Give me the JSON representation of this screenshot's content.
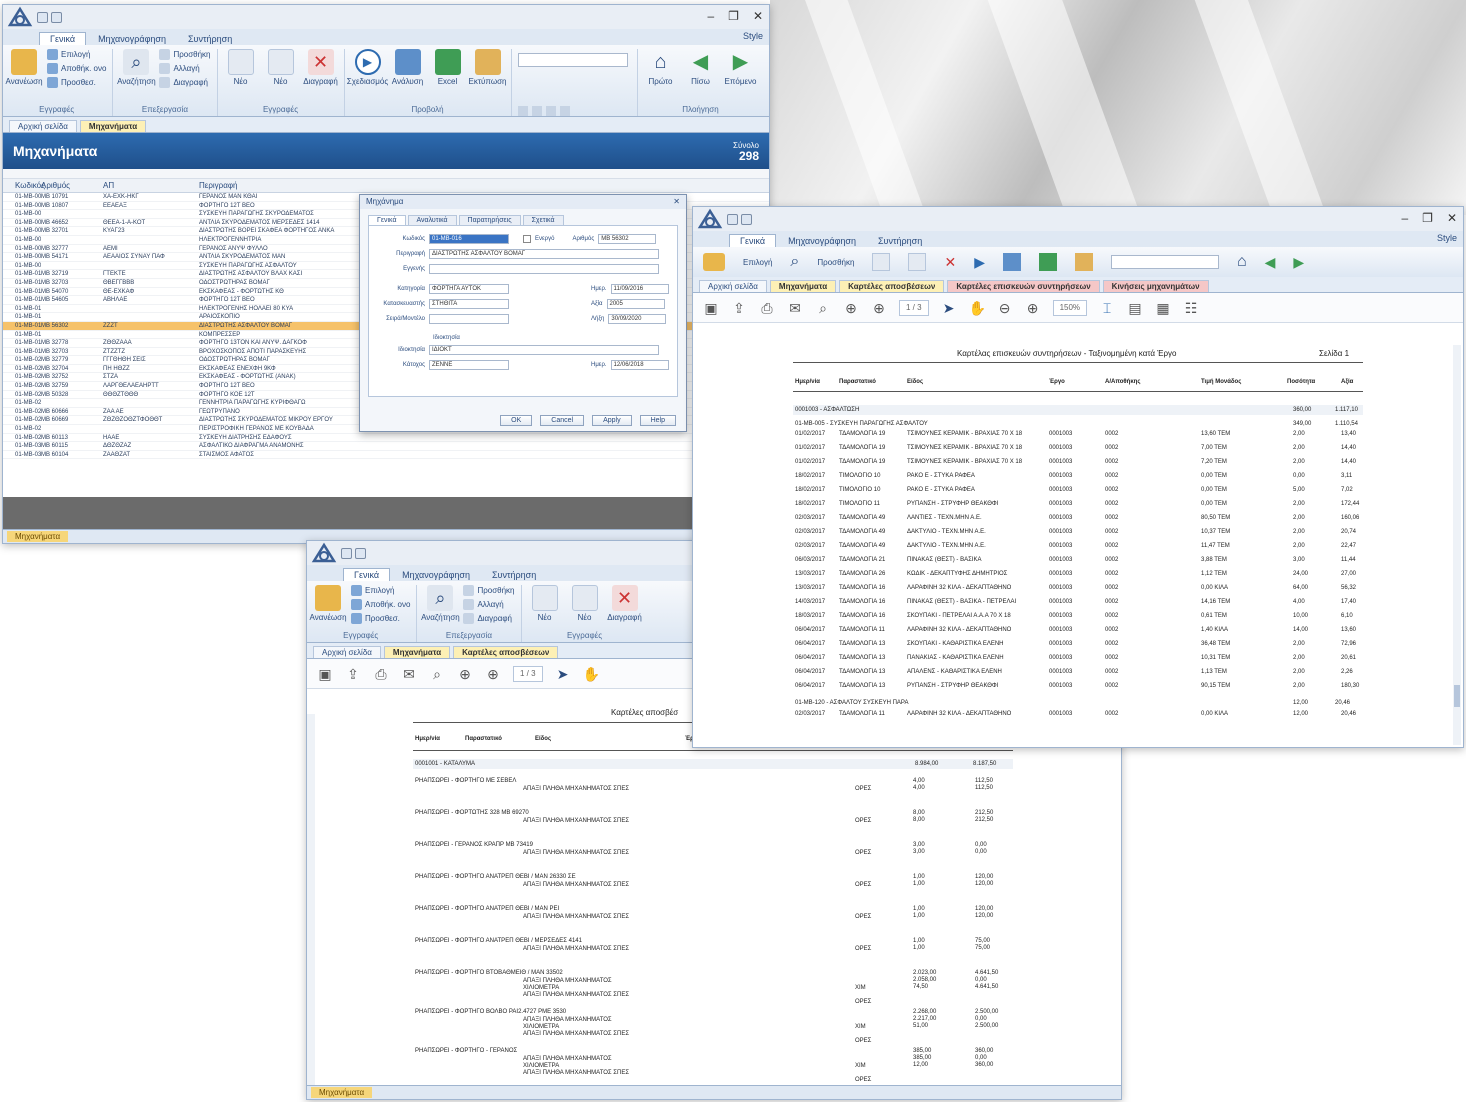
{
  "common": {
    "ribbon_tabs": [
      "Γενικά",
      "Μηχανογράφηση",
      "Συντήρηση"
    ],
    "style_label": "Style",
    "window_controls": [
      "–",
      "❐",
      "✕"
    ],
    "ribbon_groups": [
      {
        "label": "Εγγραφές",
        "big": "Ανανέωση",
        "small": [
          "Επιλογή",
          "Αποθήκ. ονο",
          "Προσθεσ."
        ]
      },
      {
        "label": "Επεξεργασία",
        "big": "Αναζήτηση",
        "small": [
          "Προσθήκη",
          "Αλλαγή",
          "Διαγραφή"
        ]
      },
      {
        "label": "Εγγραφές",
        "big": "",
        "small": [
          "Νέο",
          "Νέο",
          "Διαγραφή"
        ]
      },
      {
        "label": "Προβολή",
        "big": "",
        "small": [
          "Σχεδιασμός",
          "Ανάλυση",
          "Excel",
          "Εκτύπωση"
        ]
      },
      {
        "label": "Πλοήγηση",
        "big": "",
        "small": [
          "Πρώτο",
          "Πίσω",
          "Επόμενο"
        ]
      }
    ]
  },
  "window1": {
    "doc_tabs": [
      "Αρχική σελίδα",
      "Μηχανήματα"
    ],
    "header_title": "Μηχανήματα",
    "count_label": "Σύνολο",
    "count_value": "298",
    "columns": [
      "Κωδικός",
      "Αριθμός",
      "ΑΠ",
      "Περιγραφή"
    ],
    "rows": [
      [
        "01-ΜΒ-001",
        "ΜΒ 10791",
        "ΧΑ-ΕΧΚ-ΗΚΓ",
        "ΓΕΡΑΝΟΣ ΜΑΝ ΚΘΑΙ"
      ],
      [
        "01-ΜΒ-002",
        "ΜΒ 10807",
        "ΕΕΑΕΑΞ",
        "ΦΟΡΤΗΓΟ 12Τ ΒΕΟ"
      ],
      [
        "01-ΜΒ-003",
        "",
        "",
        "ΣΥΣΚΕΥΗ ΠΑΡΑΓΩΓΗΣ ΣΚΥΡΟΔΕΜΑΤΟΣ"
      ],
      [
        "01-ΜΒ-004",
        "ΜΒ 46652",
        "ΘΕΕΑ-1-Α-ΚΟΤ",
        "ΑΝΤΛΙΑ ΣΚΥΡΟΔΕΜΑΤΟΣ ΜΕΡΣΕΔΕΣ 1414"
      ],
      [
        "01-ΜΒ-005",
        "ΜΒ 32701",
        "ΚΥΑΓ23",
        "ΔΙΑΣΤΡΩΤΗΣ ΒΟΡΕΙ ΣΚΑΦΕΑ ΦΟΡΤΗΓΟΣ ΑΝΚΑ"
      ],
      [
        "01-ΜΒ-006",
        "",
        "",
        "ΗΛΕΚΤΡΟΓΕΝΝΗΤΡΙΑ"
      ],
      [
        "01-ΜΒ-007",
        "ΜΒ 32777",
        "ΑΕΜΙ",
        "ΓΕΡΑΝΟΣ ΑΝΥΨ ΦΥΛΛΟ"
      ],
      [
        "01-ΜΒ-008",
        "ΜΒ 54171",
        "ΑΕΑΑΙΟΣ ΣΥΝΑΥ ΠΑΦ",
        "ΑΝΤΛΙΑ ΣΚΥΡΟΔΕΜΑΤΟΣ ΜΑΝ"
      ],
      [
        "01-ΜΒ-009",
        "",
        "",
        "ΣΥΣΚΕΥΗ ΠΑΡΑΓΩΓΗΣ ΑΣΦΑΛΤΟΥ"
      ],
      [
        "01-ΜΒ-010",
        "ΜΒ 32719",
        "ΓΤΕΚΤΕ",
        "ΔΙΑΣΤΡΩΤΗΣ ΑΣΦΑΛΤΟΥ ΒΛΑΧ ΚΑΣΙ"
      ],
      [
        "01-ΜΒ-011",
        "ΜΒ 32703",
        "ΘΒΕΓΓΒΒΒ",
        "ΟΔΟΣΤΡΩΤΗΡΑΣ ΒΟΜΑΓ"
      ],
      [
        "01-ΜΒ-012",
        "ΜΒ 54070",
        "ΘΕ-ΕΧΚΑΦ",
        "ΕΚΣΚΑΦΕΑΣ - ΦΟΡΤΩΤΗΣ ΚΘ"
      ],
      [
        "01-ΜΒ-013",
        "ΜΒ 54605",
        "ΑΒΗΛΑΕ",
        "ΦΟΡΤΗΓΟ 12Τ ΒΕΟ"
      ],
      [
        "01-ΜΒ-014",
        "",
        "",
        "ΗΛΕΚΤΡΟΓΕΝΗΣ ΗΟΛΑΕΙ 80 ΚΥΑ"
      ],
      [
        "01-ΜΒ-015",
        "",
        "",
        "ΑΡΑΙΟΣΚΟΠΙΟ"
      ],
      [
        "01-ΜΒ-016",
        "ΜΒ 56302",
        "ΖΖΖΤ",
        "ΔΙΑΣΤΡΩΤΗΣ ΑΣΦΑΛΤΟΥ ΒΟΜΑΓ"
      ],
      [
        "01-ΜΒ-017",
        "",
        "",
        "ΚΟΜΠΡΕΣΣΕΡ"
      ],
      [
        "01-ΜΒ-018",
        "ΜΒ 32778",
        "ΖΘΘΖΑΑΑ",
        "ΦΟΡΤΗΓΟ 13ΤΟΝ ΚΑΙ ΑΝΥΨ. ΔΑΓΚΟΦ"
      ],
      [
        "01-ΜΒ-019",
        "ΜΒ 32703",
        "ΖΤΖΖΤΖ",
        "ΒΡΟΧΟΣΚΟΠΟΣ ΑΠΟΤΙ ΠΑΡΑΣΚΕΥΗΣ"
      ],
      [
        "01-ΜΒ-020",
        "ΜΒ 32779",
        "ΓΓΓΘΗΘΗ ΣΕΙΣ",
        "ΟΔΟΣΤΡΩΤΗΡΑΣ ΒΟΜΑΓ"
      ],
      [
        "01-ΜΒ-021",
        "ΜΒ 32704",
        "ΠΗ ΗΘΖΖ",
        "ΕΚΣΚΑΦΕΑΣ ΕΝΕΧΦΗ 9ΚΦ"
      ],
      [
        "01-ΜΒ-022",
        "ΜΒ 32752",
        "ΣΤΖΑ",
        "ΕΚΣΚΑΦΕΑΣ - ΦΟΡΤΩΤΗΣ (ΑΝΑΚ)"
      ],
      [
        "01-ΜΒ-023",
        "ΜΒ 32759",
        "ΛΑΡΓΘΕΛΑΕΑΗΡΤΤ",
        "ΦΟΡΤΗΓΟ 12Τ ΒΕΟ"
      ],
      [
        "01-ΜΒ-024",
        "ΜΒ 50328",
        "ΘΘΘΖΤΘΘΘ",
        "ΦΟΡΤΗΓΟ ΚΟΕ 12Τ"
      ],
      [
        "01-ΜΒ-025",
        "",
        "",
        "ΓΕΝΝΗΤΡΙΑ ΠΑΡΑΓΩΓΗΣ ΚΥΡΙΦΘΑΓΩ"
      ],
      [
        "01-ΜΒ-026",
        "ΜΒ 60666",
        "ΖΑΑ ΑΕ",
        "ΓΕΩΤΡΥΠΑΝΟ"
      ],
      [
        "01-ΜΒ-027",
        "ΜΒ 60669",
        "ΖΘΖΘΖΟΘΖΤΦΟΘΘΤ",
        "ΔΙΑΣΤΡΩΤΗΣ ΣΚΥΡΟΔΕΜΑΤΟΣ ΜΙΚΡΟΥ ΕΡΓΟΥ"
      ],
      [
        "01-ΜΒ-028",
        "",
        "",
        "ΠΕΡΙΣΤΡΟΦΙΚΗ ΓΕΡΑΝΟΣ ΜΕ ΚΟΥΒΑΔΑ"
      ],
      [
        "01-ΜΒ-029",
        "ΜΒ 60113",
        "ΗΑΑΕ",
        "ΣΥΣΚΕΥΗ ΔΙΑΤΡΗΣΗΣ ΕΔΑΦΟΥΣ"
      ],
      [
        "01-ΜΒ-030",
        "ΜΒ 60115",
        "ΔΘΖΘΖΑΖ",
        "ΑΣΦΑΛΤΙΚΟ ΔΙΑΦΡΑΓΜΑ ΑΝΑΜΟΝΗΣ"
      ],
      [
        "01-ΜΒ-031",
        "ΜΒ 60104",
        "ΖΑΑΘΖΑΤ",
        "ΣΤΑΙΣΜΟΣ ΑΦΑΤΟΣ"
      ]
    ],
    "selected_row": 15,
    "dialog": {
      "title": "Μηχάνημα",
      "tabs": [
        "Γενικά",
        "Αναλυτικά",
        "Παρατηρήσεις",
        "Σχετικά"
      ],
      "fields": [
        {
          "label": "Κωδικός",
          "value": "01-ΜΒ-016"
        },
        {
          "label": "Περιγραφή",
          "value": "ΔΙΑΣΤΡΩΤΗΣ ΑΣΦΑΛΤΟΥ ΒΟΜΑΓ"
        },
        {
          "label": "Εγγενής",
          "value": ""
        },
        {
          "label": "Κατηγορία",
          "value": "ΦΟΡΤΗΓΑ ΑΥΤΟΚ"
        },
        {
          "label": "Κατασκευαστής",
          "value": "ΣΤΗΘΙΤΑ"
        },
        {
          "label": "Σειρά/Μοντέλο",
          "value": ""
        },
        {
          "label": "Ιδιοκτησία",
          "value": "ΙΔΙΟΚΤ"
        },
        {
          "label": "Κάτοχος",
          "value": "ΖΕΝΝΕ"
        }
      ],
      "right_fields": [
        {
          "label": "Αριθμός",
          "value": "ΜΒ 56302"
        },
        {
          "label": "Ημερ.",
          "value": "11/09/2016"
        },
        {
          "label": "Αξία",
          "value": "2005"
        },
        {
          "label": "Λήξη",
          "value": "30/09/2020"
        },
        {
          "label": "Ημερ.",
          "value": "12/06/2018"
        }
      ],
      "checkbox_label": "Ενεργό",
      "section_label": "Ιδιοκτησία",
      "buttons": [
        "OK",
        "Cancel",
        "Apply",
        "Help"
      ]
    },
    "status_tab": "Μηχανήματα"
  },
  "window2": {
    "doc_tabs": [
      "Αρχική σελίδα",
      "Μηχανήματα",
      "Καρτέλες αποσβέσεων",
      "Καρτέλες επισκευών συντηρήσεων",
      "Κινήσεις μηχανημάτων"
    ],
    "zoom": "150%",
    "page_label": "1 / 3",
    "report_title": "Καρτέλας επισκευών συντηρήσεων - Ταξινομημένη κατά Έργο",
    "page_no": "Σελίδα 1",
    "columns": [
      "Ημερ/νία",
      "Παραστατικό",
      "Είδος",
      "Έργο",
      "Α/Αποθήκης",
      "Τιμή Μονάδος",
      "Ποσότητα",
      "Αξία"
    ],
    "group1": {
      "label": "0001003 - ΑΣΦΑΛΤΩΣΗ",
      "qty": "360,00",
      "total": "1.117,10"
    },
    "subgroup1": {
      "label": "01-ΜΒ-005 - ΣΥΣΚΕΥΗ ΠΑΡΑΓΩΓΗΣ ΑΣΦΑΛΤΟΥ",
      "qty": "349,00",
      "total": "1.110,54"
    },
    "rows": [
      [
        "01/02/2017",
        "ΤΔΑΜΟΛΟΓΙΑ 19",
        "ΤΣΙΜΟΥΝΕΣ ΚΕΡΑΜΙΚ - ΒΡΑΧΙΑΣ 70 Χ 18",
        "0001003",
        "0002",
        "13,60 ΤΕΜ",
        "2,00",
        "13,40"
      ],
      [
        "01/02/2017",
        "ΤΔΑΜΟΛΟΓΙΑ 19",
        "ΤΣΙΜΟΥΝΕΣ ΚΕΡΑΜΙΚ - ΒΡΑΧΙΑΣ 70 Χ 18",
        "0001003",
        "0002",
        "7,00 ΤΕΜ",
        "2,00",
        "14,40"
      ],
      [
        "01/02/2017",
        "ΤΔΑΜΟΛΟΓΙΑ 19",
        "ΤΣΙΜΟΥΝΕΣ ΚΕΡΑΜΙΚ - ΒΡΑΧΙΑΣ 70 Χ 18",
        "0001003",
        "0002",
        "7,20 ΤΕΜ",
        "2,00",
        "14,40"
      ],
      [
        "18/02/2017",
        "ΤΙΜΟΛΟΓΙΟ 10",
        "ΡΑΚΟ Ε - ΣΤΥΚΑ ΡΑΦΕΑ",
        "0001003",
        "0002",
        "0,00 ΤΕΜ",
        "0,00",
        "3,11"
      ],
      [
        "18/02/2017",
        "ΤΙΜΟΛΟΓΙΟ 10",
        "ΡΑΚΟ Ε - ΣΤΥΚΑ ΡΑΦΕΑ",
        "0001003",
        "0002",
        "0,00 ΤΕΜ",
        "5,00",
        "7,02"
      ],
      [
        "18/02/2017",
        "ΤΙΜΟΛΟΓΙΟ 11",
        "ΡΥΠΑΝΣΗ - ΣΤΡΥΦΗΡ ΘΕΑΚΘΦΙ",
        "0001003",
        "0002",
        "0,00 ΤΕΜ",
        "2,00",
        "172,44"
      ],
      [
        "02/03/2017",
        "ΤΔΑΜΟΛΟΓΙΑ 49",
        "ΛΑΝΤΙΕΣ - ΤΕΧΝ.ΜΗΝ Α.Ε.",
        "0001003",
        "0002",
        "80,50 ΤΕΜ",
        "2,00",
        "160,06"
      ],
      [
        "02/03/2017",
        "ΤΔΑΜΟΛΟΓΙΑ 49",
        "ΔΑΚΤΥΛΙΟ - ΤΕΧΝ.ΜΗΝ Α.Ε.",
        "0001003",
        "0002",
        "10,37 ΤΕΜ",
        "2,00",
        "20,74"
      ],
      [
        "02/03/2017",
        "ΤΔΑΜΟΛΟΓΙΑ 49",
        "ΔΑΚΤΥΛΙΟ - ΤΕΧΝ.ΜΗΝ Α.Ε.",
        "0001003",
        "0002",
        "11,47 ΤΕΜ",
        "2,00",
        "22,47"
      ],
      [
        "06/03/2017",
        "ΤΔΑΜΟΛΟΓΙΑ 21",
        "ΠΙΝΑΚΑΣ (ΘΕΣΤ) - ΒΑΣΙΚΑ",
        "0001003",
        "0002",
        "3,88 ΤΕΜ",
        "3,00",
        "11,44"
      ],
      [
        "13/03/2017",
        "ΤΔΑΜΟΛΟΓΙΑ 26",
        "ΚΩΔΙΚ - ΔΕΚΑΠΤΥΦΗΣ ΔΗΜΗΤΡΙΟΣ",
        "0001003",
        "0002",
        "1,12 ΤΕΜ",
        "24,00",
        "27,00"
      ],
      [
        "13/03/2017",
        "ΤΔΑΜΟΛΟΓΙΑ 16",
        "ΛΑΡΑΦΙΝΗ 32 ΚΙΛΑ - ΔΕΚΑΠΤΑΘΗΝΟ",
        "0001003",
        "0002",
        "0,00 ΚΙΛΑ",
        "64,00",
        "56,32"
      ],
      [
        "14/03/2017",
        "ΤΔΑΜΟΛΟΓΙΑ 16",
        "ΠΙΝΑΚΑΣ (ΘΕΣΤ) - ΒΑΣΙΚΑ - ΠΕΤΡΕΛΑΙ",
        "0001003",
        "0002",
        "14,16 ΤΕΜ",
        "4,00",
        "17,40"
      ],
      [
        "18/03/2017",
        "ΤΔΑΜΟΛΟΓΙΑ 16",
        "ΣΚΟΥΠΑΚΙ - ΠΕΤΡΕΛΑΙ Α.Α.Α 70 Χ 18",
        "0001003",
        "0002",
        "0,61 ΤΕΜ",
        "10,00",
        "6,10"
      ],
      [
        "06/04/2017",
        "ΤΔΑΜΟΛΟΓΙΑ 11",
        "ΛΑΡΑΦΙΝΗ 32 ΚΙΛΑ - ΔΕΚΑΠΤΑΘΗΝΟ",
        "0001003",
        "0002",
        "1,40 ΚΙΛΑ",
        "14,00",
        "13,60"
      ],
      [
        "06/04/2017",
        "ΤΔΑΜΟΛΟΓΙΑ 13",
        "ΣΚΟΥΠΑΚΙ - ΚΑΘΑΡΙΣΤΙΚΑ ΕΛΕΝΗ",
        "0001003",
        "0002",
        "36,48 ΤΕΜ",
        "2,00",
        "72,96"
      ],
      [
        "06/04/2017",
        "ΤΔΑΜΟΛΟΓΙΑ 13",
        "ΠΑΝΑΚΙΑΣ - ΚΑΘΑΡΙΣΤΙΚΑ ΕΛΕΝΗ",
        "0001003",
        "0002",
        "10,31 ΤΕΜ",
        "2,00",
        "20,61"
      ],
      [
        "06/04/2017",
        "ΤΔΑΜΟΛΟΓΙΑ 13",
        "ΑΠΑΛΕΝΣ - ΚΑΘΑΡΙΣΤΙΚΑ ΕΛΕΝΗ",
        "0001003",
        "0002",
        "1,13 ΤΕΜ",
        "2,00",
        "2,26"
      ],
      [
        "06/04/2017",
        "ΤΔΑΜΟΛΟΓΙΑ 13",
        "ΡΥΠΑΝΣΗ - ΣΤΡΥΦΗΡ ΘΕΑΚΘΦΙ",
        "0001003",
        "0002",
        "90,15 ΤΕΜ",
        "2,00",
        "180,30"
      ]
    ],
    "subgroup2": {
      "label": "01-ΜΒ-120 - ΑΣΦΑΛΤΟΥ ΣΥΣΚΕΥΗ ΠΑΡΑ",
      "qty": "12,00",
      "total": "20,46"
    },
    "row_last": [
      "02/03/2017",
      "ΤΔΑΜΟΛΟΓΙΑ 11",
      "ΛΑΡΑΦΙΝΗ 32 ΚΙΛΑ - ΔΕΚΑΠΤΑΘΗΝΟ",
      "0001003",
      "0002",
      "0,00 ΚΙΛΑ",
      "12,00",
      "20,46"
    ]
  },
  "window3": {
    "doc_tabs": [
      "Αρχική σελίδα",
      "Μηχανήματα",
      "Καρτέλες αποσβέσεων"
    ],
    "page_label": "1 / 3",
    "report_title": "Καρτέλες αποσβέσ",
    "columns": [
      "Ημερ/νία",
      "Παραστατικό",
      "Είδος",
      "Έρ"
    ],
    "group_label": "0001001 - ΚΑΤΑΛΥΜΑ",
    "group_qty": "8.984,00",
    "group_total": "8.187,50",
    "items": [
      {
        "head": "ΡΗΑΠΣΩΡΕΙ - ΦΟΡΤΗΓΟ ΜΕ ΣΕΒΕΛ",
        "lines": [
          "ΑΠΑΞΙ ΠΛΗΘΑ ΜΗΧΑΝΗΜΑΤΟΣ ΣΠΕΣ"
        ],
        "tags": [
          "ΟΡΕΣ"
        ],
        "q": [
          "4,00",
          "4,00"
        ],
        "v": [
          "112,50",
          "112,50"
        ]
      },
      {
        "head": "ΡΗΑΠΣΩΡΕΙ - ΦΟΡΤΩΤΗΣ 328 ΜΒ 69270",
        "lines": [
          "ΑΠΑΞΙ ΠΛΗΘΑ ΜΗΧΑΝΗΜΑΤΟΣ ΣΠΕΣ"
        ],
        "tags": [
          "ΟΡΕΣ"
        ],
        "q": [
          "8,00",
          "8,00"
        ],
        "v": [
          "212,50",
          "212,50"
        ]
      },
      {
        "head": "ΡΗΑΠΣΩΡΕΙ - ΓΕΡΑΝΟΣ ΚΡΑΠΡ ΜΒ 73419",
        "lines": [
          "ΑΠΑΞΙ ΠΛΗΘΑ ΜΗΧΑΝΗΜΑΤΟΣ ΣΠΕΣ"
        ],
        "tags": [
          "ΟΡΕΣ"
        ],
        "q": [
          "3,00",
          "3,00"
        ],
        "v": [
          "0,00",
          "0,00"
        ]
      },
      {
        "head": "ΡΗΑΠΣΩΡΕΙ - ΦΟΡΤΗΓΟ ΑΝΑΤΡΕΠ ΘΕΒΙ / ΜΑΝ 26330 ΣΕ",
        "lines": [
          "ΑΠΑΞΙ ΠΛΗΘΑ ΜΗΧΑΝΗΜΑΤΟΣ ΣΠΕΣ"
        ],
        "tags": [
          "ΟΡΕΣ"
        ],
        "q": [
          "1,00",
          "1,00"
        ],
        "v": [
          "120,00",
          "120,00"
        ]
      },
      {
        "head": "ΡΗΑΠΣΩΡΕΙ - ΦΟΡΤΗΓΟ ΑΝΑΤΡΕΠ ΘΕΒΙ / ΜΑΝ ΡΕΙ",
        "lines": [
          "ΑΠΑΞΙ ΠΛΗΘΑ ΜΗΧΑΝΗΜΑΤΟΣ ΣΠΕΣ"
        ],
        "tags": [
          "ΟΡΕΣ"
        ],
        "q": [
          "1,00",
          "1,00"
        ],
        "v": [
          "120,00",
          "120,00"
        ]
      },
      {
        "head": "ΡΗΑΠΣΩΡΕΙ - ΦΟΡΤΗΓΟ ΑΝΑΤΡΕΠ ΘΕΒΙ / ΜΕΡΣΕΔΕΣ 4141",
        "lines": [
          "ΑΠΑΞΙ ΠΛΗΘΑ ΜΗΧΑΝΗΜΑΤΟΣ ΣΠΕΣ"
        ],
        "tags": [
          "ΟΡΕΣ"
        ],
        "q": [
          "1,00",
          "1,00"
        ],
        "v": [
          "75,00",
          "75,00"
        ]
      },
      {
        "head": "ΡΗΑΠΣΩΡΕΙ - ΦΟΡΤΗΓΟ ΒΤΟΒΑΘΜΕΙΘ / ΜΑΝ 33502",
        "lines": [
          "ΑΠΑΞΙ ΠΛΗΘΑ ΜΗΧΑΝΗΜΑΤΟΣ",
          "ΧΙΛΙΟΜΕΤΡΑ",
          "ΑΠΑΞΙ ΠΛΗΘΑ ΜΗΧΑΝΗΜΑΤΟΣ ΣΠΕΣ"
        ],
        "tags": [
          "ΧΙΜ",
          "ΟΡΕΣ"
        ],
        "q": [
          "2.023,00",
          "2.058,00",
          "74,50"
        ],
        "v": [
          "4.641,50",
          "0,00",
          "4.641,50"
        ]
      },
      {
        "head": "ΡΗΑΠΣΩΡΕΙ - ΦΟΡΤΗΓΟ ΒΟΛΒΟ ΡΑΙ2.4727 ΡΜΕ 3530",
        "lines": [
          "ΑΠΑΞΙ ΠΛΗΘΑ ΜΗΧΑΝΗΜΑΤΟΣ",
          "ΧΙΛΙΟΜΕΤΡΑ",
          "ΑΠΑΞΙ ΠΛΗΘΑ ΜΗΧΑΝΗΜΑΤΟΣ ΣΠΕΣ"
        ],
        "tags": [
          "ΧΙΜ",
          "ΟΡΕΣ"
        ],
        "q": [
          "2.268,00",
          "2.217,00",
          "51,00"
        ],
        "v": [
          "2.500,00",
          "0,00",
          "2.500,00"
        ]
      },
      {
        "head": "ΡΗΑΠΣΩΡΕΙ - ΦΟΡΤΗΓΟ - ΓΕΡΑΝΟΣ",
        "lines": [
          "ΑΠΑΞΙ ΠΛΗΘΑ ΜΗΧΑΝΗΜΑΤΟΣ",
          "ΧΙΛΙΟΜΕΤΡΑ",
          "ΑΠΑΞΙ ΠΛΗΘΑ ΜΗΧΑΝΗΜΑΤΟΣ ΣΠΕΣ"
        ],
        "tags": [
          "ΧΙΜ",
          "ΟΡΕΣ"
        ],
        "q": [
          "385,00",
          "385,00",
          "12,00"
        ],
        "v": [
          "360,00",
          "0,00",
          "360,00"
        ]
      }
    ],
    "status_tab": "Μηχανήματα"
  }
}
